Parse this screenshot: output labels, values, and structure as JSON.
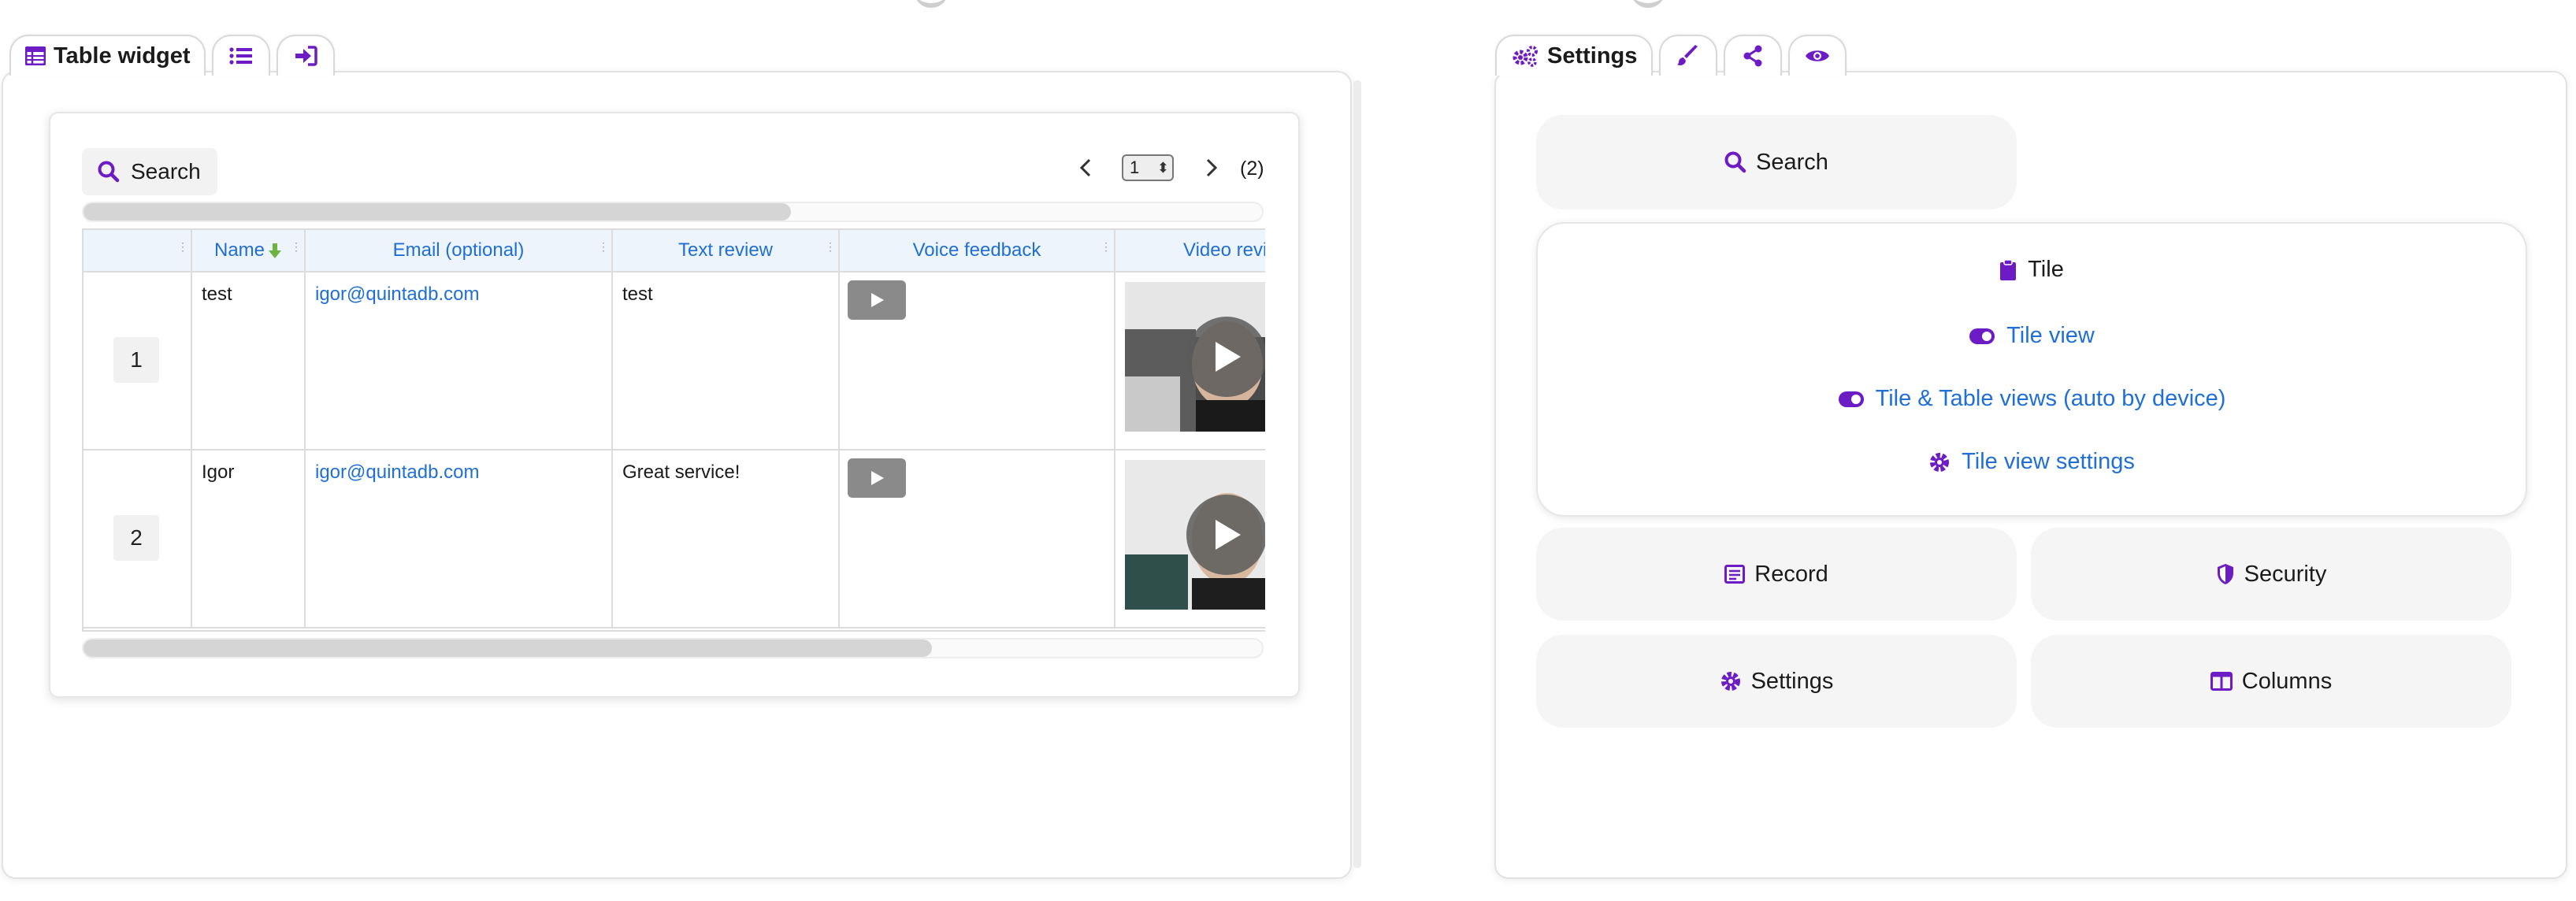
{
  "left_tabs": {
    "main_label": "Table widget",
    "icons": [
      "table-icon",
      "list-icon",
      "sign-in-icon"
    ]
  },
  "table_widget": {
    "search_label": "Search",
    "page_current": "1",
    "page_total": "(2)",
    "columns": [
      "Name",
      "Email (optional)",
      "Text review",
      "Voice feedback",
      "Video revi"
    ],
    "rows": [
      {
        "num": "1",
        "name": "test",
        "email": "igor@quintadb.com",
        "text": "test"
      },
      {
        "num": "2",
        "name": "Igor",
        "email": "igor@quintadb.com",
        "text": "Great service!"
      }
    ],
    "sort_indicator": "arrow-down-icon",
    "top_scroll_fraction": 0.6,
    "bottom_scroll_fraction": 0.72
  },
  "right_tabs": {
    "main_label": "Settings",
    "icons": [
      "cogs-icon",
      "brush-icon",
      "share-icon",
      "eye-icon"
    ]
  },
  "settings": {
    "search_label": "Search",
    "tile_label": "Tile",
    "tile_view_label": "Tile view",
    "tile_table_label": "Tile & Table views (auto by device)",
    "tile_settings_label": "Tile view settings",
    "record_label": "Record",
    "security_label": "Security",
    "settings_label": "Settings",
    "columns_label": "Columns"
  },
  "colors": {
    "accent": "#6d1bc4",
    "link": "#1f6fd6",
    "button_bg": "#f5f5f5"
  }
}
